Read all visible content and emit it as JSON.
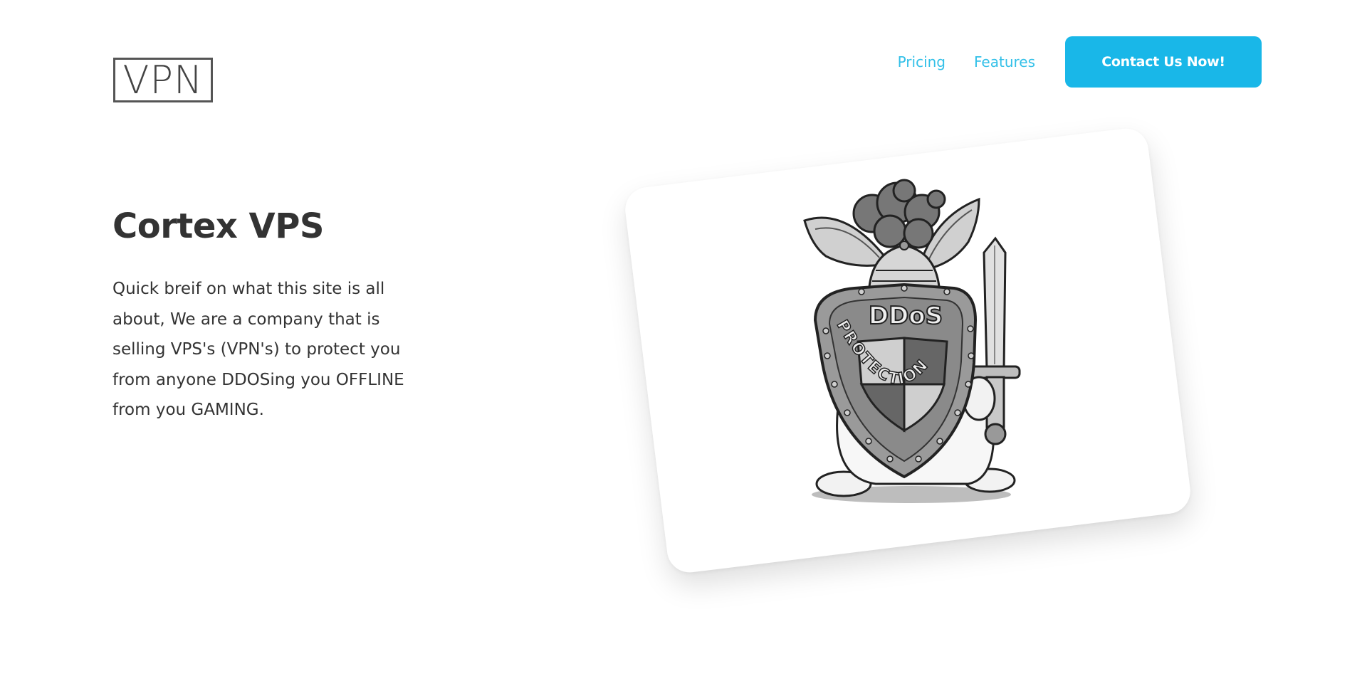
{
  "header": {
    "logo_text": "VPN",
    "nav": [
      {
        "label": "Pricing"
      },
      {
        "label": "Features"
      }
    ],
    "cta_label": "Contact Us Now!"
  },
  "hero": {
    "title": "Cortex VPS",
    "description": "Quick breif on what this site is all about, We are a company that is selling VPS's (VPN's) to protect you from anyone DDOSing you OFFLINE from you GAMING."
  },
  "illustration": {
    "shield_top_text": "DDoS",
    "shield_ring_text": "PROTECTION",
    "icon": "bunny-knight-ddos-shield"
  },
  "colors": {
    "accent": "#19b7e8",
    "link": "#33c0e8",
    "text": "#333333"
  }
}
